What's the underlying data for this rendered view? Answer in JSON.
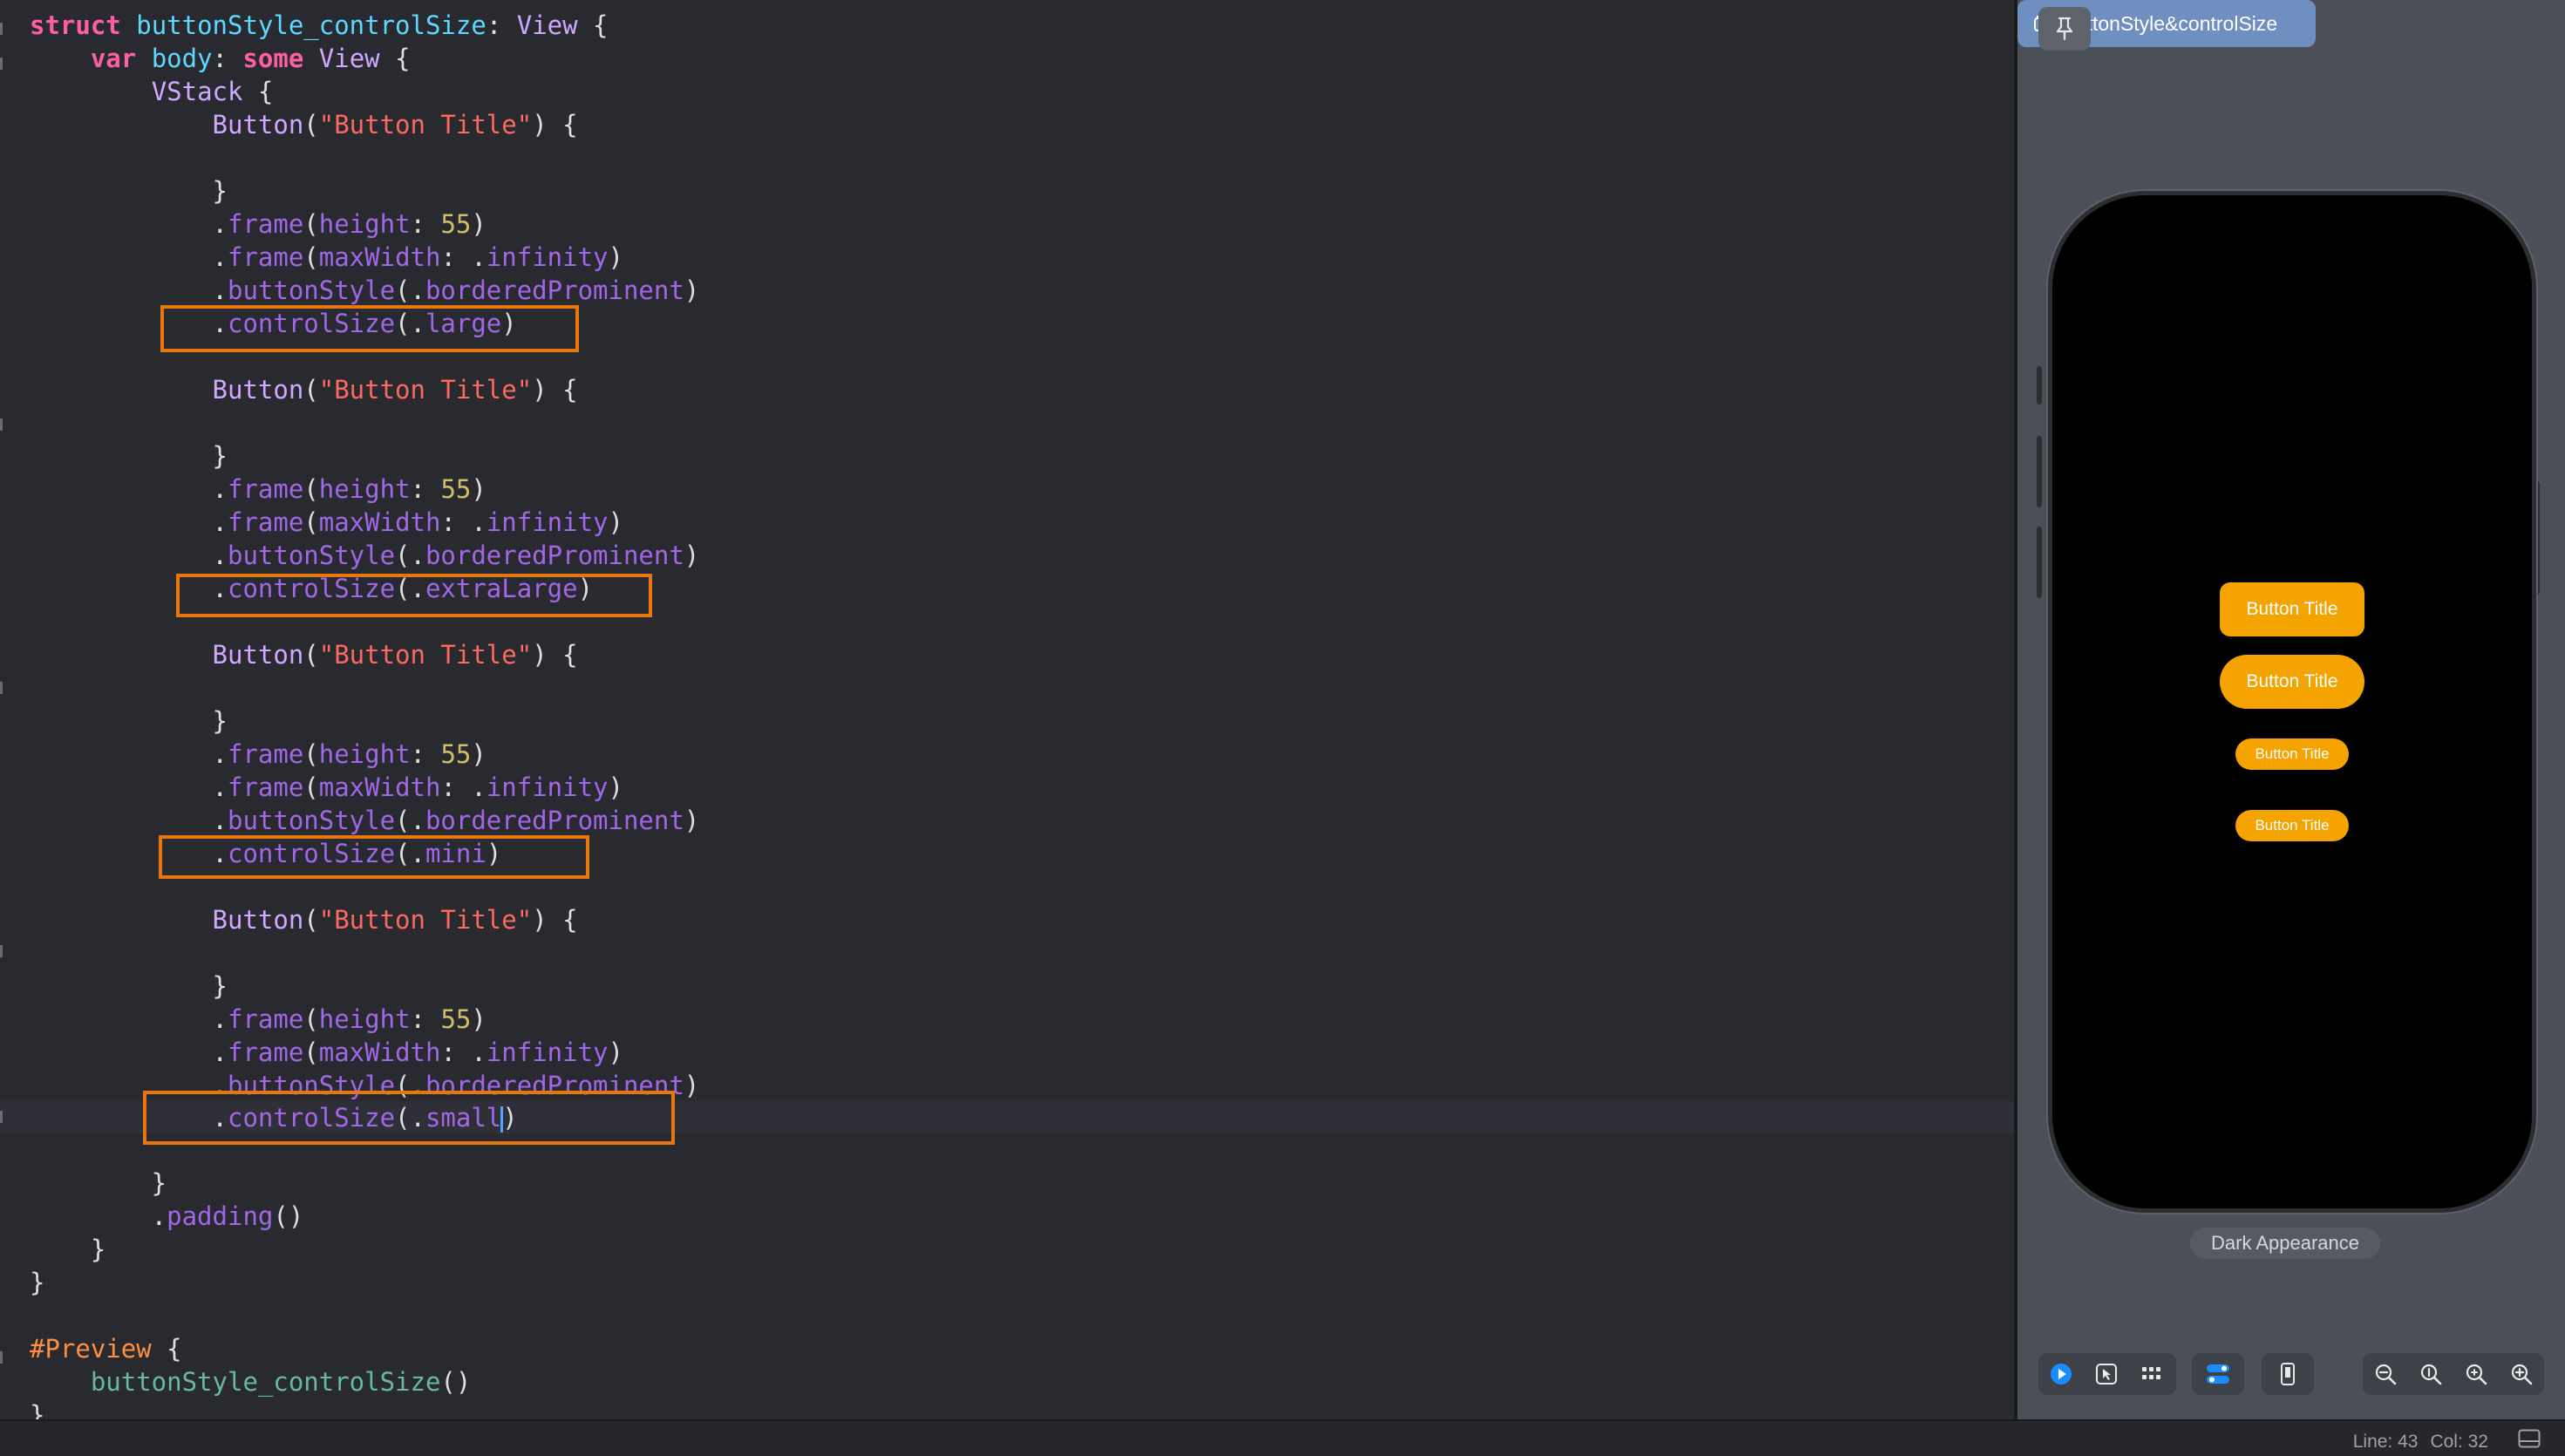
{
  "editor": {
    "code": {
      "struct_kw": "struct",
      "struct_name": "buttonStyle_controlSize",
      "colon_space": ": ",
      "view_type": "View",
      "open_brace": " {",
      "var_kw": "var",
      "body_name": "body",
      "some_kw": "some",
      "vstack": "VStack",
      "button_fn": "Button",
      "button_title": "\"Button Title\"",
      "frame_fn": "frame",
      "height_label": "height",
      "height_value": "55",
      "maxwidth_label": "maxWidth",
      "infinity": "infinity",
      "buttonstyle_fn": "buttonStyle",
      "bordered_prominent": "borderedProminent",
      "controlsize_fn": "controlSize",
      "size_large": "large",
      "size_extra_large": "extraLarge",
      "size_mini": "mini",
      "size_small": "small",
      "padding_fn": "padding",
      "preview_macro": "#Preview",
      "preview_call": "buttonStyle_controlSize"
    }
  },
  "preview": {
    "tab_label": "buttonStyle&controlSize",
    "buttons": [
      {
        "label": "Button Title",
        "size": "large"
      },
      {
        "label": "Button Title",
        "size": "extraLarge"
      },
      {
        "label": "Button Title",
        "size": "mini"
      },
      {
        "label": "Button Title",
        "size": "small"
      }
    ],
    "appearance_label": "Dark Appearance",
    "controls": {
      "left_group": [
        "live-play-icon",
        "select-cursor-icon",
        "grid-variants-icon"
      ],
      "settings_icon": "device-settings-icon",
      "device_icon": "device-icon",
      "zoom_group": [
        "zoom-out-icon",
        "zoom-actual-icon",
        "zoom-fit-icon",
        "zoom-in-icon"
      ]
    }
  },
  "status": {
    "line": "Line: 43",
    "col": "Col: 32"
  },
  "colors": {
    "keyword": "#fc5fa3",
    "type": "#d0a8ff",
    "function": "#a167e6",
    "string": "#fc6a5d",
    "number": "#d0bf69",
    "highlight_box": "#e8760e",
    "preview_button": "#f4a300",
    "editor_background": "#292a30"
  }
}
